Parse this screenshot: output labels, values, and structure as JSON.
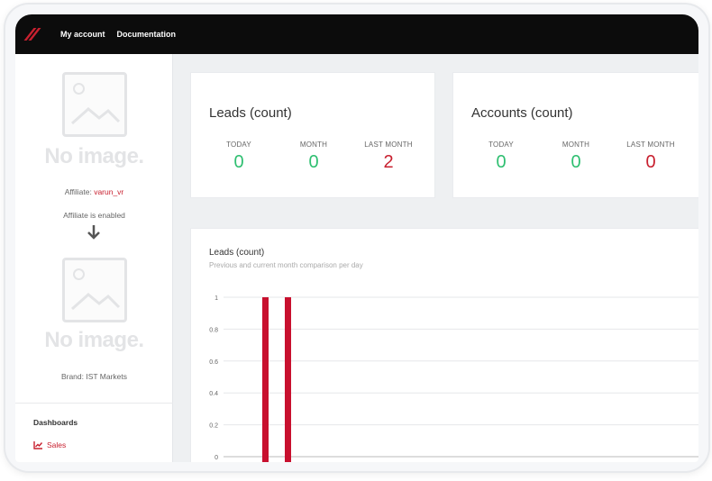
{
  "topbar": {
    "links": [
      "My account",
      "Documentation"
    ]
  },
  "sidebar": {
    "placeholder_text": "No image.",
    "affiliate_label": "Affiliate:",
    "affiliate_name": "varun_vr",
    "affiliate_status": "Affiliate is enabled",
    "brand_text": "Brand: IST Markets",
    "section_heading": "Dashboards",
    "items": [
      {
        "label": "Sales",
        "icon": "line-chart-icon"
      }
    ]
  },
  "leads_card": {
    "title": "Leads (count)",
    "stats": [
      {
        "label": "TODAY",
        "value": "0",
        "color": "#2fbf71"
      },
      {
        "label": "MONTH",
        "value": "0",
        "color": "#2fbf71"
      },
      {
        "label": "LAST MONTH",
        "value": "2",
        "color": "#c8202f"
      }
    ]
  },
  "accounts_card": {
    "title": "Accounts (count)",
    "stats": [
      {
        "label": "TODAY",
        "value": "0",
        "color": "#2fbf71"
      },
      {
        "label": "MONTH",
        "value": "0",
        "color": "#2fbf71"
      },
      {
        "label": "LAST MONTH",
        "value": "0",
        "color": "#c8202f"
      }
    ]
  },
  "chart": {
    "title": "Leads (count)",
    "subtitle": "Previous and current month comparison per day"
  },
  "chart_data": {
    "type": "bar",
    "title": "Leads (count)",
    "subtitle": "Previous and current month comparison per day",
    "y_ticks": [
      "1",
      "0.8",
      "0.6",
      "0.4",
      "0.2",
      "0"
    ],
    "ylim": [
      0,
      1
    ],
    "grid": true,
    "series": [
      {
        "values": [
          1,
          1
        ],
        "color": "#c8102e"
      }
    ]
  }
}
